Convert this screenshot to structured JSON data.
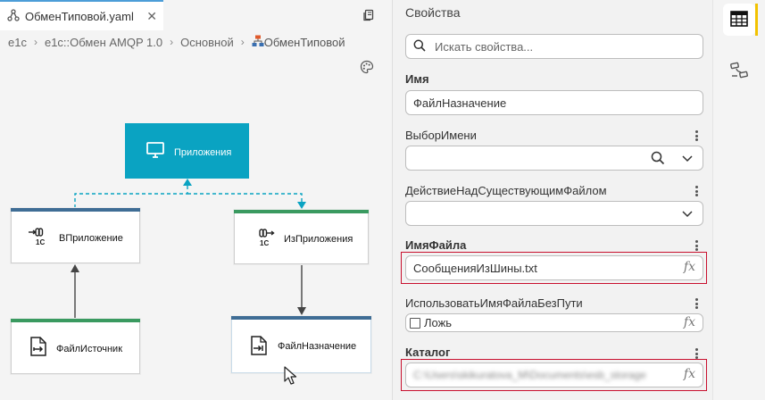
{
  "editor": {
    "tab_title": "ОбменТиповой.yaml",
    "breadcrumb": [
      "e1c",
      "e1c::Обмен AMQP 1.0",
      "Основной",
      "ОбменТиповой"
    ]
  },
  "diagram": {
    "nodes": {
      "apps": "Приложения",
      "vpril": "ВПриложение",
      "izpril": "ИзПриложения",
      "src": "ФайлИсточник",
      "dst": "ФайлНазначение"
    },
    "logo_text": "1С"
  },
  "props": {
    "title": "Свойства",
    "search_placeholder": "Искать свойства...",
    "name_label": "Имя",
    "name_value": "ФайлНазначение",
    "choice_label": "ВыборИмени",
    "choice_value": "",
    "action_label": "ДействиеНадСуществующимФайлом",
    "action_value": "",
    "filename_label": "ИмяФайла",
    "filename_value": "СообщенияИзШины.txt",
    "usename_label": "ИспользоватьИмяФайлаБезПути",
    "usename_value": "Ложь",
    "catalog_label": "Каталог",
    "catalog_value": "C:\\Users\\skikuratova_M\\Documents\\esb_storage",
    "fx": "fx"
  },
  "colors": {
    "accent_teal": "#0aa3c2",
    "bar_blue": "#3f6d95",
    "bar_green": "#3a9a60",
    "edge_dashed": "#0aa3c2",
    "edge_solid": "#444444",
    "highlight_red": "#c8102e",
    "rail_active": "#f2c200"
  },
  "icons": {
    "tab": "diagram-icon",
    "copy": "copy-icon",
    "palette": "palette-icon",
    "search": "search-icon",
    "dropdown": "chevron-down-icon",
    "table": "table-icon",
    "structure": "structure-icon"
  }
}
